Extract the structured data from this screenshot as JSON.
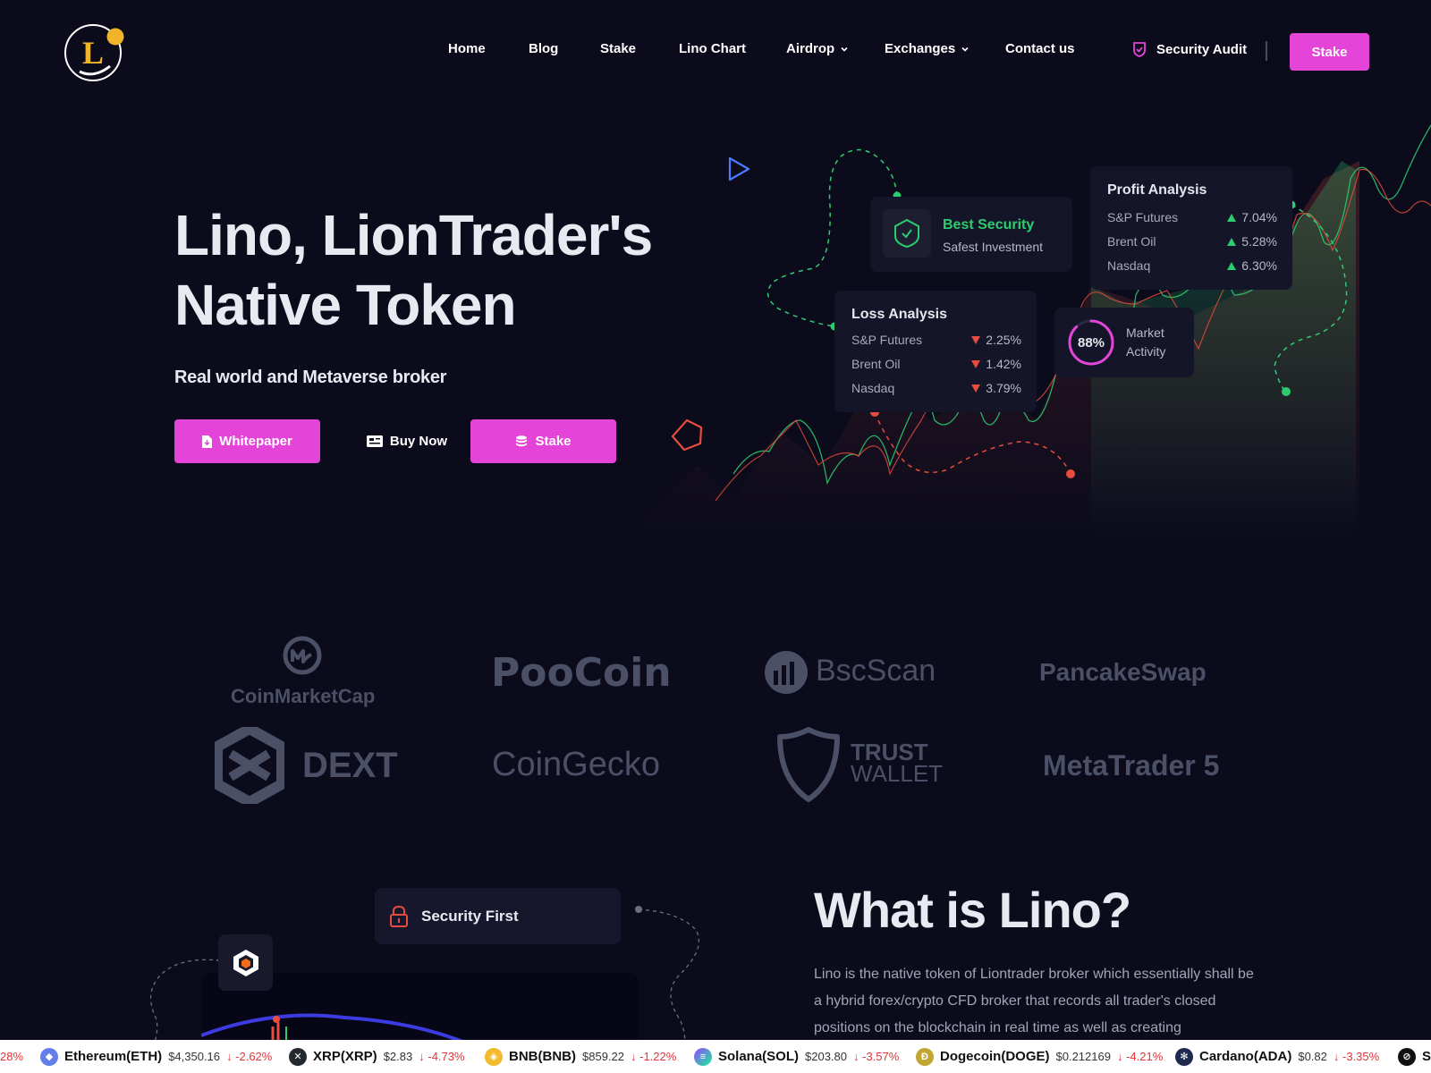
{
  "brand": {
    "logo_letter": "L"
  },
  "nav": {
    "items": [
      {
        "label": "Home"
      },
      {
        "label": "Blog"
      },
      {
        "label": "Stake"
      },
      {
        "label": "Lino Chart"
      },
      {
        "label": "Airdrop",
        "dropdown": true
      },
      {
        "label": "Exchanges",
        "dropdown": true
      },
      {
        "label": "Contact us"
      }
    ],
    "security_audit": "Security Audit",
    "stake_button": "Stake"
  },
  "hero": {
    "title_line1": "Lino, LionTrader's",
    "title_line2": "Native Token",
    "subtitle": "Real world and Metaverse broker",
    "buttons": {
      "whitepaper": "Whitepaper",
      "buy_now": "Buy Now",
      "stake": "Stake"
    }
  },
  "cards": {
    "security": {
      "title": "Best Security",
      "subtitle": "Safest Investment"
    },
    "profit": {
      "title": "Profit Analysis",
      "rows": [
        {
          "name": "S&P Futures",
          "value": "7.04%"
        },
        {
          "name": "Brent Oil",
          "value": "5.28%"
        },
        {
          "name": "Nasdaq",
          "value": "6.30%"
        }
      ]
    },
    "loss": {
      "title": "Loss Analysis",
      "rows": [
        {
          "name": "S&P Futures",
          "value": "2.25%"
        },
        {
          "name": "Brent Oil",
          "value": "1.42%"
        },
        {
          "name": "Nasdaq",
          "value": "3.79%"
        }
      ]
    },
    "market": {
      "value": "88%",
      "fraction": 0.88,
      "label_line1": "Market",
      "label_line2": "Activity"
    }
  },
  "partners": [
    "CoinMarketCap",
    "PooCoin",
    "BscScan",
    "PancakeSwap",
    "DEXT",
    "CoinGecko",
    "TRUST",
    "WALLET",
    "MetaTrader 5"
  ],
  "what_is": {
    "title": "What is Lino?",
    "text": "Lino is the native token of Liontrader broker which essentially shall be a hybrid forex/crypto CFD broker that records all trader's closed positions on the blockchain in real time as well as creating",
    "security_first": "Security First"
  },
  "ticker": {
    "lead_change": "28%",
    "items": [
      {
        "name": "Ethereum(ETH)",
        "price": "$4,350.16",
        "change": "-2.62%",
        "color": "#627eea",
        "icon": "ethereum-icon"
      },
      {
        "name": "XRP(XRP)",
        "price": "$2.83",
        "change": "-4.73%",
        "color": "#23292f",
        "icon": "xrp-icon"
      },
      {
        "name": "BNB(BNB)",
        "price": "$859.22",
        "change": "-1.22%",
        "color": "#f3ba2f",
        "icon": "bnb-icon"
      },
      {
        "name": "Solana(SOL)",
        "price": "$203.80",
        "change": "-3.57%",
        "color": "#9945ff",
        "icon": "solana-icon"
      },
      {
        "name": "Dogecoin(DOGE)",
        "price": "$0.212169",
        "change": "-4.21%",
        "color": "#c2a633",
        "icon": "dogecoin-icon"
      },
      {
        "name": "Cardano(ADA)",
        "price": "$0.82",
        "change": "-3.35%",
        "color": "#1e2a4f",
        "icon": "cardano-icon"
      },
      {
        "name": "S",
        "price": "",
        "change": "",
        "color": "#111111",
        "icon": "coin-icon"
      }
    ]
  },
  "colors": {
    "accent": "#e444d8",
    "up": "#2ecc71",
    "down": "#e74c3c",
    "background": "#0b0b1c"
  }
}
